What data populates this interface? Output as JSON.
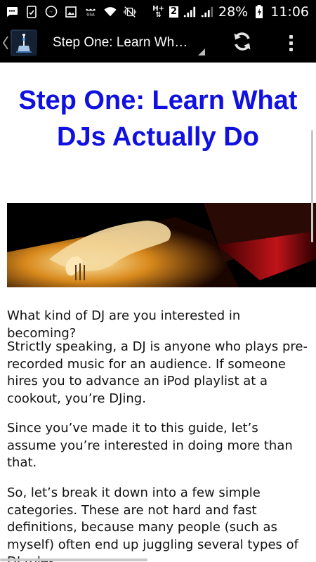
{
  "status_bar": {
    "battery_percent": "28%",
    "time": "11:06",
    "network_type": "H+",
    "sim_badge": "2",
    "icons": [
      "message-icon",
      "android-icon",
      "messenger-icon",
      "image-icon",
      "gsa-icon",
      "wifi-icon",
      "vibrate-off-icon",
      "data-arrows-icon",
      "signal-icon",
      "battery-charging-icon"
    ]
  },
  "action_bar": {
    "title": "Step One: Learn What DJs Actually Do",
    "icons": [
      "back-chevron-icon",
      "app-logo-icon",
      "refresh-icon",
      "overflow-menu-icon"
    ]
  },
  "article": {
    "heading": "Step One: Learn What DJs Actually Do",
    "hero_image": "dj-hand-on-turntable",
    "paragraphs": [
      "What kind of DJ are you interested in becoming?",
      "Strictly speaking, a DJ is anyone who plays pre-recorded music for an audience. If someone hires you to advance an iPod playlist at a cookout, you’re DJing.",
      "Since you’ve made it to this guide, let’s assume you’re interested in doing more than that.",
      "So, let’s break it down into a few simple categories. These are not hard and fast definitions, because many people (such as myself) often end up juggling several types of DJ roles."
    ]
  },
  "colors": {
    "heading": "#1010e0",
    "bars": "#000000",
    "body_text": "#111111"
  }
}
